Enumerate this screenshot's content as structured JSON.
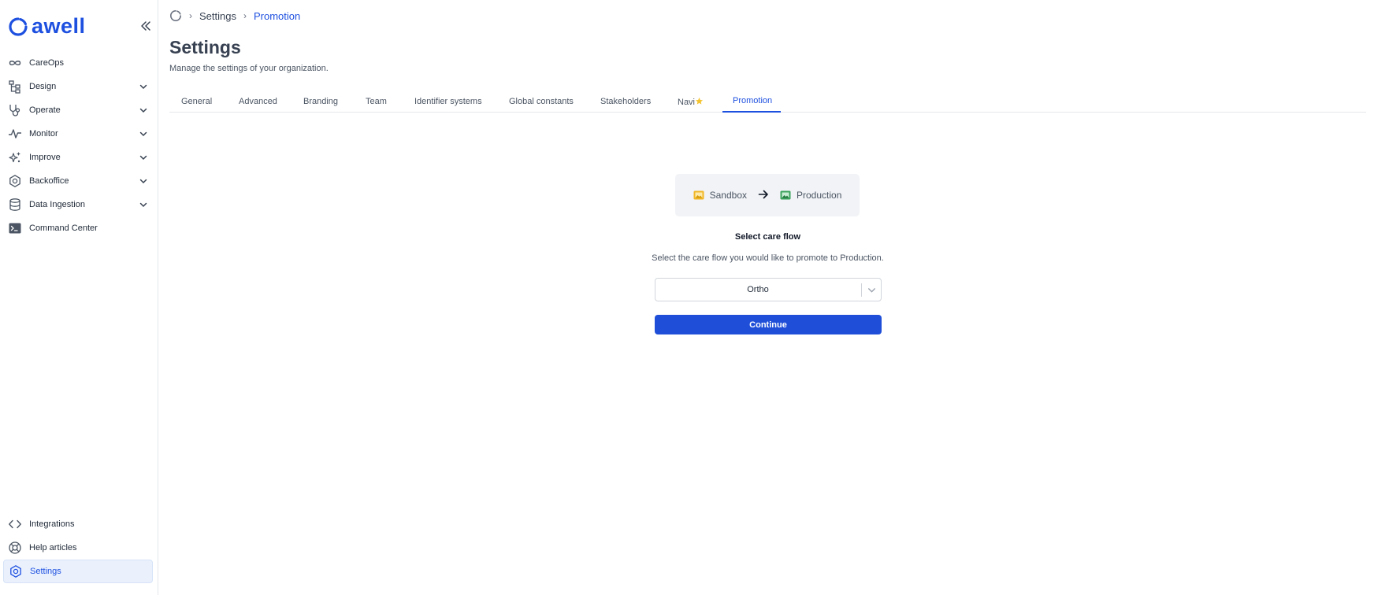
{
  "brand": {
    "name": "awell",
    "accent": "#1e50e0"
  },
  "sidebar": {
    "items": [
      {
        "label": "CareOps",
        "icon": "infinity-icon",
        "expandable": false
      },
      {
        "label": "Design",
        "icon": "hierarchy-icon",
        "expandable": true
      },
      {
        "label": "Operate",
        "icon": "stethoscope-icon",
        "expandable": true
      },
      {
        "label": "Monitor",
        "icon": "pulse-icon",
        "expandable": true
      },
      {
        "label": "Improve",
        "icon": "sparkles-icon",
        "expandable": true
      },
      {
        "label": "Backoffice",
        "icon": "gear-hex-icon",
        "expandable": true
      },
      {
        "label": "Data Ingestion",
        "icon": "database-icon",
        "expandable": true
      },
      {
        "label": "Command Center",
        "icon": "terminal-icon",
        "expandable": false
      }
    ],
    "bottom_items": [
      {
        "label": "Integrations",
        "icon": "code-icon"
      },
      {
        "label": "Help articles",
        "icon": "lifebuoy-icon"
      },
      {
        "label": "Settings",
        "icon": "settings-icon",
        "active": true
      }
    ]
  },
  "breadcrumb": {
    "settings": "Settings",
    "current": "Promotion"
  },
  "page": {
    "title": "Settings",
    "subtitle": "Manage the settings of your organization."
  },
  "tabs": [
    {
      "label": "General"
    },
    {
      "label": "Advanced"
    },
    {
      "label": "Branding"
    },
    {
      "label": "Team"
    },
    {
      "label": "Identifier systems"
    },
    {
      "label": "Global constants"
    },
    {
      "label": "Stakeholders"
    },
    {
      "label": "Navi",
      "badge": "star-icon"
    },
    {
      "label": "Promotion",
      "active": true
    }
  ],
  "promotion": {
    "from_env": "Sandbox",
    "from_color": "#f2b728",
    "to_env": "Production",
    "to_color": "#3aa35c",
    "select_title": "Select care flow",
    "select_description": "Select the care flow you would like to promote to Production.",
    "selected_care_flow": "Ortho",
    "continue_label": "Continue"
  }
}
